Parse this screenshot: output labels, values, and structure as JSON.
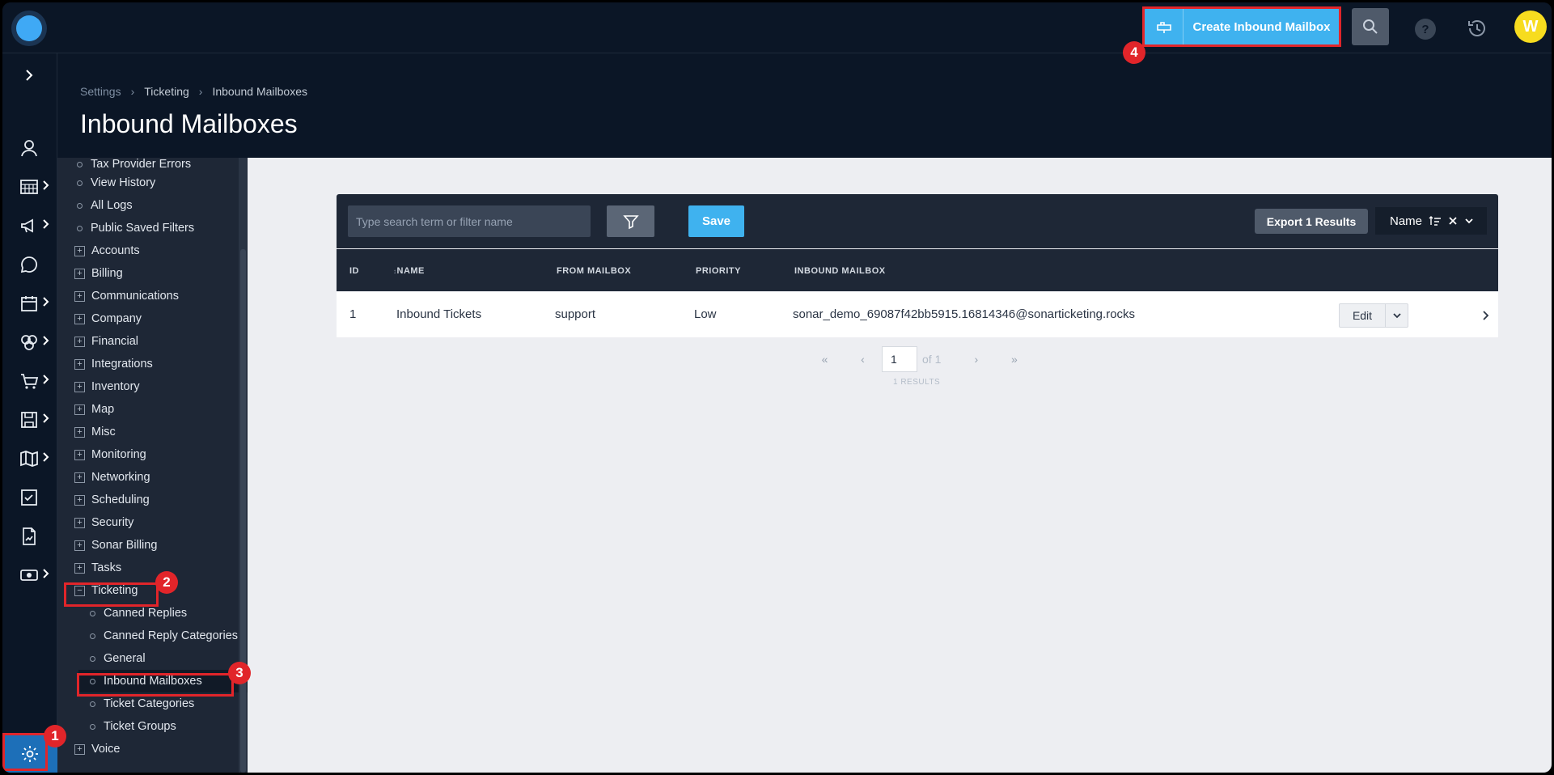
{
  "topbar": {
    "create_label": "Create Inbound Mailbox",
    "help_label": "?",
    "avatar_initial": "W"
  },
  "breadcrumb": [
    "Settings",
    "Ticketing",
    "Inbound Mailboxes"
  ],
  "page_title": "Inbound Mailboxes",
  "rail_icons": [
    "expand-chevron-icon",
    "user-icon",
    "calendar-grid-icon",
    "megaphone-icon",
    "chat-bubble-icon",
    "calendar-icon",
    "network-icon",
    "cart-icon",
    "save-disk-icon",
    "map-icon",
    "checkbox-icon",
    "report-icon",
    "cash-icon",
    "gear-icon"
  ],
  "tree": {
    "top_items": [
      "Tax Provider Errors",
      "View History",
      "All Logs",
      "Public Saved Filters"
    ],
    "sections": [
      "Accounts",
      "Billing",
      "Communications",
      "Company",
      "Financial",
      "Integrations",
      "Inventory",
      "Map",
      "Misc",
      "Monitoring",
      "Networking",
      "Scheduling",
      "Security",
      "Sonar Billing",
      "Tasks"
    ],
    "ticketing_label": "Ticketing",
    "ticketing_children": [
      "Canned Replies",
      "Canned Reply Categories",
      "General",
      "Inbound Mailboxes",
      "Ticket Categories",
      "Ticket Groups"
    ],
    "bottom_section": "Voice"
  },
  "toolbar": {
    "search_placeholder": "Type search term or filter name",
    "save_label": "Save",
    "export_label": "Export 1 Results",
    "sort_label": "Name"
  },
  "table": {
    "columns": [
      "ID",
      "NAME",
      "FROM MAILBOX",
      "PRIORITY",
      "INBOUND MAILBOX"
    ],
    "rows": [
      {
        "id": "1",
        "name": "Inbound Tickets",
        "from_mailbox": "support",
        "priority": "Low",
        "inbound_mailbox": "sonar_demo_69087f42bb5915.16814346@sonarticketing.rocks"
      }
    ],
    "edit_label": "Edit"
  },
  "pagination": {
    "first": "«",
    "prev": "‹",
    "page": "1",
    "of_label": "of 1",
    "next": "›",
    "last": "»",
    "results_label": "1 RESULTS"
  },
  "annotations": [
    "1",
    "2",
    "3",
    "4"
  ],
  "colors": {
    "accent": "#3fb2ef",
    "highlight": "#e1252a",
    "dark_bg": "#0b1626",
    "panel": "#1e2736"
  }
}
